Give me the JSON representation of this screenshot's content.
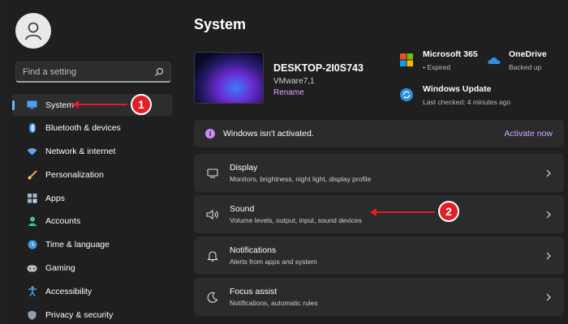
{
  "sidebar": {
    "search_placeholder": "Find a setting",
    "items": [
      {
        "label": "System",
        "icon": "monitor-icon",
        "active": true
      },
      {
        "label": "Bluetooth & devices",
        "icon": "bluetooth-icon"
      },
      {
        "label": "Network & internet",
        "icon": "wifi-icon"
      },
      {
        "label": "Personalization",
        "icon": "brush-icon"
      },
      {
        "label": "Apps",
        "icon": "apps-icon"
      },
      {
        "label": "Accounts",
        "icon": "person-icon"
      },
      {
        "label": "Time & language",
        "icon": "globe-clock-icon"
      },
      {
        "label": "Gaming",
        "icon": "gamepad-icon"
      },
      {
        "label": "Accessibility",
        "icon": "accessibility-icon"
      },
      {
        "label": "Privacy & security",
        "icon": "shield-icon"
      }
    ]
  },
  "main": {
    "title": "System",
    "device": {
      "name": "DESKTOP-2I0S743",
      "model": "VMware7,1",
      "rename": "Rename"
    },
    "quick": {
      "m365": {
        "title": "Microsoft 365",
        "status": "• Expired"
      },
      "onedrive": {
        "title": "OneDrive",
        "status": "Backed up"
      },
      "update": {
        "title": "Windows Update",
        "status": "Last checked: 4 minutes ago"
      }
    },
    "banner": {
      "text": "Windows isn't activated.",
      "action": "Activate now"
    },
    "cards": [
      {
        "title": "Display",
        "subtitle": "Monitors, brightness, night light, display profile",
        "icon": "display-icon"
      },
      {
        "title": "Sound",
        "subtitle": "Volume levels, output, input, sound devices",
        "icon": "speaker-icon"
      },
      {
        "title": "Notifications",
        "subtitle": "Alerts from apps and system",
        "icon": "bell-icon"
      },
      {
        "title": "Focus assist",
        "subtitle": "Notifications, automatic rules",
        "icon": "moon-icon"
      }
    ]
  },
  "annotations": {
    "step1": "1",
    "step2": "2"
  },
  "colors": {
    "accent": "#d6a6ff",
    "annotation": "#e21f26",
    "background": "#1f1f1f",
    "card": "#2b2b2b"
  }
}
